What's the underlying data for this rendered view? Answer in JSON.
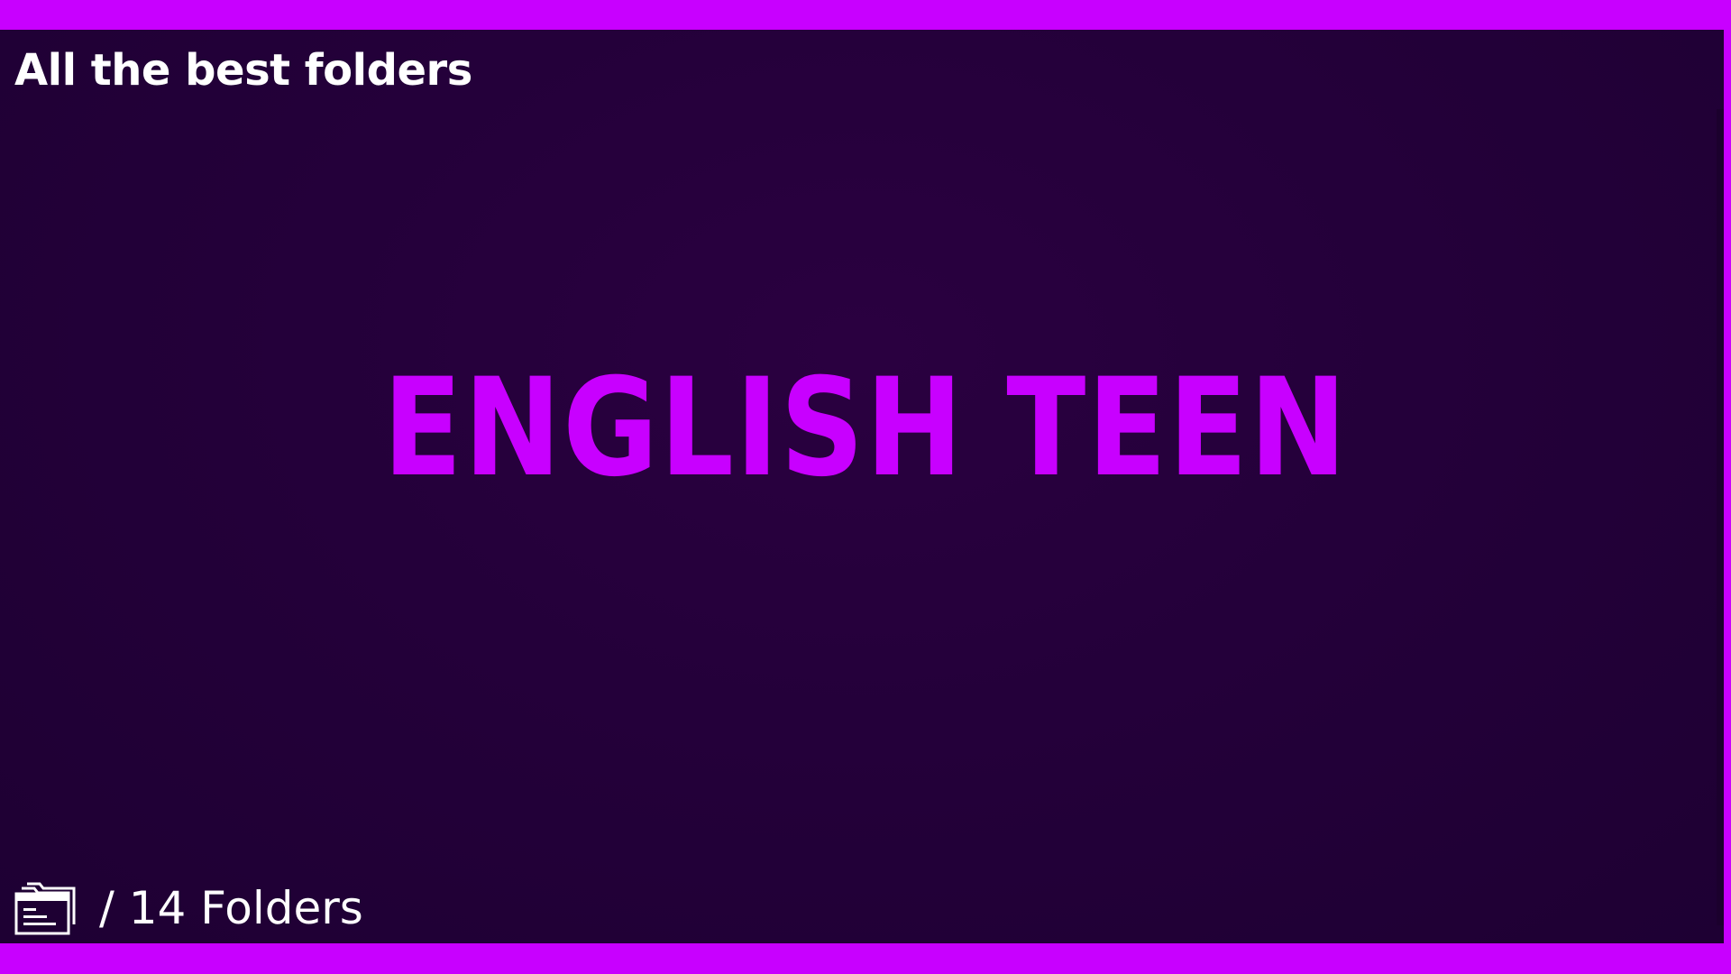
{
  "header": {
    "title": "All the best folders"
  },
  "main": {
    "headline": "ENGLISH TEEN"
  },
  "footer": {
    "icon": "folder-icon",
    "count_label": "/ 14 Folders"
  },
  "colors": {
    "accent": "#c800ff",
    "background": "#24003a",
    "text": "#ffffff"
  }
}
